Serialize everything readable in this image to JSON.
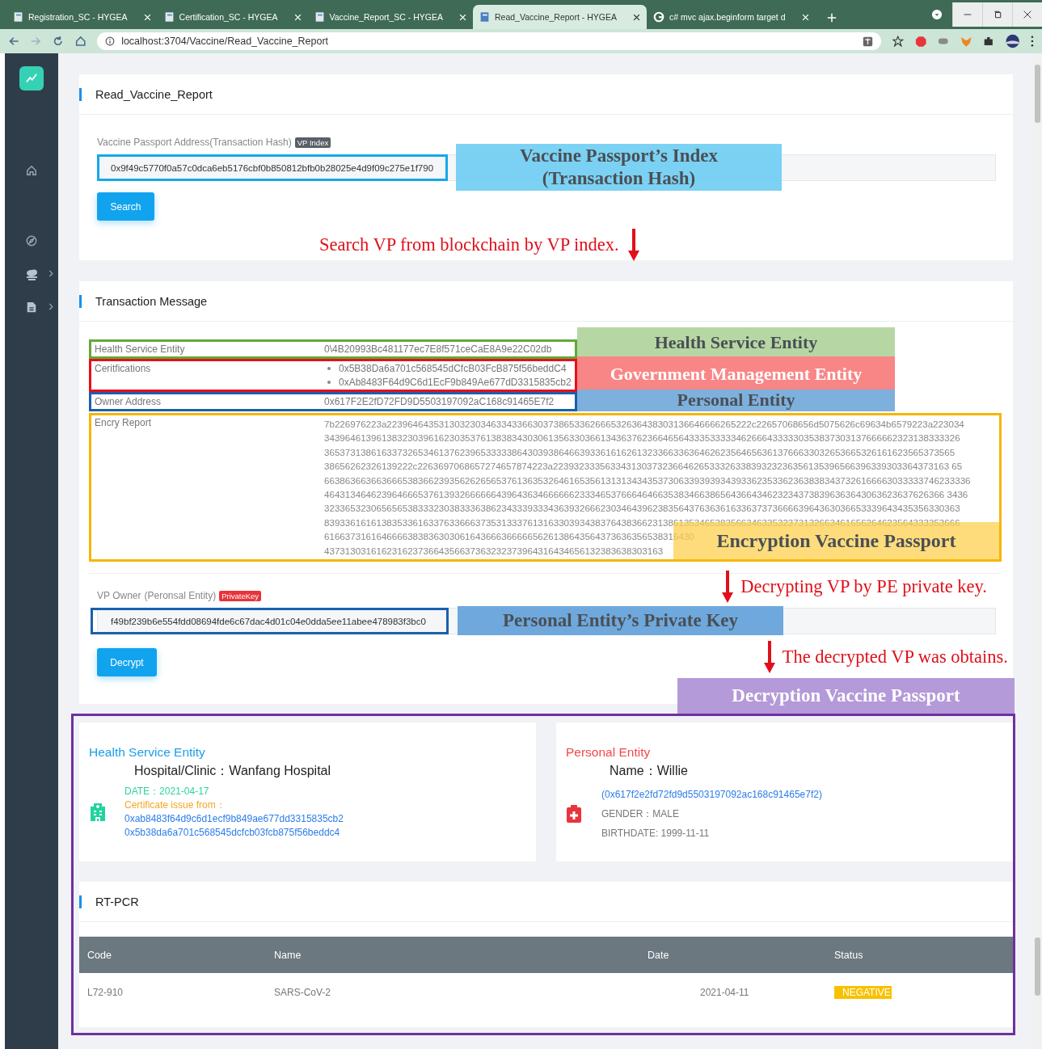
{
  "browser": {
    "tabs": [
      {
        "title": "Registration_SC - HYGEA",
        "selected": false,
        "kind": "page"
      },
      {
        "title": "Certification_SC - HYGEA",
        "selected": false,
        "kind": "page"
      },
      {
        "title": "Vaccine_Report_SC - HYGEA",
        "selected": false,
        "kind": "page"
      },
      {
        "title": "Read_Vaccine_Report - HYGEA",
        "selected": true,
        "kind": "page"
      },
      {
        "title": "c# mvc ajax.beginform target d",
        "selected": false,
        "kind": "search"
      }
    ],
    "address": "localhost:3704/Vaccine/Read_Vaccine_Report"
  },
  "sidebar": {
    "items": [
      {
        "kind": "home",
        "has_children": false
      },
      {
        "kind": "compass",
        "has_children": false
      },
      {
        "kind": "cloud",
        "has_children": true
      },
      {
        "kind": "document",
        "has_children": true
      }
    ]
  },
  "search_card": {
    "title": "Read_Vaccine_Report",
    "field_label": "Vaccine Passport Address(Transaction Hash)",
    "field_badge": "VP Index",
    "field_value": "0x9f49c5770f0a57c0dca6eb5176cbf0b850812bfb0b28025e4d9f09c275e1f790",
    "annotation": [
      "Vaccine Passport’s Index",
      "(Transaction Hash)"
    ],
    "button": "Search",
    "note": "Search VP from blockchain by VP index."
  },
  "transaction_card": {
    "title": "Transaction Message",
    "rows": [
      {
        "label": "Health Service Entity",
        "values": [
          "0\\4B20993Bc481177ec7E8f571ceCaE8A9e22C02db"
        ],
        "kind": "plain",
        "color": "#62a83a",
        "annotation": {
          "text": "Health Service Entity",
          "color": "#b6d7a3"
        }
      },
      {
        "label": "Ceritfications",
        "values": [
          "0x5B38Da6a701c568545dCfcB03FcB875f56beddC4",
          "0xAb8483F64d9C6d1EcF9b849Ae677dD3315835cb2"
        ],
        "kind": "list",
        "color": "#e8101a",
        "annotation": {
          "text": "Government Management Entity",
          "color": "#f98686"
        }
      },
      {
        "label": "Owner Address",
        "values": [
          "0x617F2E2fD72FD9D5503197092aC168c91465E7f2"
        ],
        "kind": "plain",
        "color": "#1a5fae",
        "annotation": {
          "text": "Personal Entity",
          "color": "#7eb0de"
        }
      }
    ],
    "report": {
      "label": "Encry Report",
      "lines": [
        "7b226976223a2239646435313032303463343366303738653362666532636438303136646666265222c22657068656d5075626c69634b6579223a223034",
        "34396461396138323039616230353761383834303061356330366134363762366465643335333334626664333330353837303137666662323138333326",
        "3653731386163373265346137623965333338643039386466393361616261323366336364626235646563613766633032653665326161623565373565",
        "38656262326139222c2263697068657274657874223a2239323335633431303732366462653332633839323236356135396566396339303364373163 65",
        "6638636636636665383662393562626565376136353264616535613131343435373063393939343933623533623638383437326166663033333746233336",
        "46431346462396466653761393266666643964363466666623334653766646466353834663865643664346232343738396363643063623637626366 3436",
        "32336532306565653833323038333638623433393334363932666230346439623835643763636163363737366663964363036653339643435356330363",
        "83933616161383533616337633666373531333761316330393438376438366231386135346538356634633532373132663461656264623564333353666",
        "61663731616466663838363030616436663666665626138643564373636356538316430",
        "43731303161623162373664356637363232373964316434656132383638303163"
      ],
      "annotation": "Encryption Vaccine Passport"
    },
    "note_decrypt": "Decrypting VP by PE private key.",
    "owner_label": "VP Owner",
    "owner_hint": "(Peronsal Entity)",
    "owner_badge": "PrivateKey",
    "owner_value": "f49bf239b6e554fdd08694fde6c67dac4d01c04e0dda5ee11abee478983f3bc0",
    "owner_annotation": "Personal Entity’s Private Key",
    "button": "Decrypt",
    "note_result": "The decrypted VP was obtains.",
    "result_annotation": "Decryption Vaccine Passport"
  },
  "result": {
    "health": {
      "heading": "Health Service Entity",
      "name": "Hospital/Clinic：Wanfang Hospital",
      "date": "DATE：2021-04-17",
      "issue_label": "Certificate issue from：",
      "issuers": [
        "0xab8483f64d9c6d1ecf9b849ae677dd3315835cb2",
        "0x5b38da6a701c568545dcfcb03fcb875f56beddc4"
      ]
    },
    "person": {
      "heading": "Personal Entity",
      "name": "Name：Willie",
      "address": "(0x617f2e2fd72fd9d5503197092ac168c91465e7f2)",
      "gender": "GENDER：MALE",
      "birthdate": "BIRTHDATE: 1999-11-11"
    },
    "test": {
      "title": "RT-PCR",
      "columns": [
        "Code",
        "Name",
        "Date",
        "Status"
      ],
      "rows": [
        {
          "code": "L72-910",
          "name": "SARS-CoV-2",
          "date": "2021-04-11",
          "status": "NEGATIVE",
          "kind": "negative"
        }
      ]
    }
  }
}
